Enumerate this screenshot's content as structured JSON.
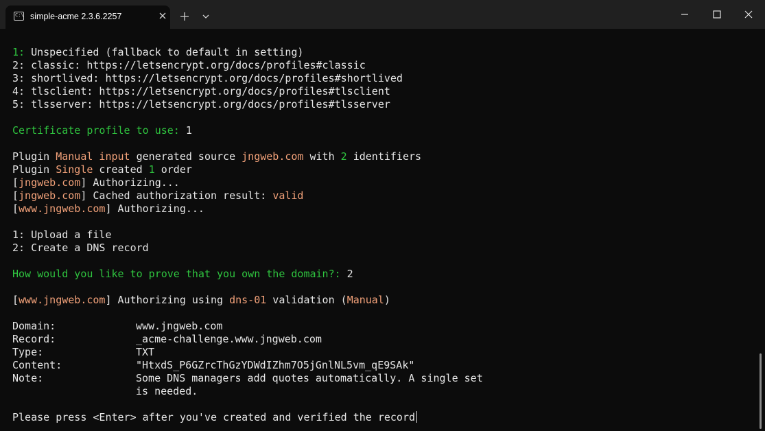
{
  "window": {
    "tab_title": "simple-acme 2.3.6.2257"
  },
  "terminal": {
    "profiles": [
      {
        "num": "1:",
        "text": " Unspecified (fallback to default in setting)"
      },
      {
        "num": "2:",
        "text": " classic: https://letsencrypt.org/docs/profiles#classic"
      },
      {
        "num": "3:",
        "text": " shortlived: https://letsencrypt.org/docs/profiles#shortlived"
      },
      {
        "num": "4:",
        "text": " tlsclient: https://letsencrypt.org/docs/profiles#tlsclient"
      },
      {
        "num": "5:",
        "text": " tlsserver: https://letsencrypt.org/docs/profiles#tlsserver"
      }
    ],
    "profile_prompt": "Certificate profile to use:",
    "profile_answer": " 1",
    "plugin1": [
      "Plugin ",
      "Manual input",
      " generated source ",
      "jngweb.com",
      " with ",
      "2",
      " identifiers"
    ],
    "plugin2": [
      "Plugin ",
      "Single",
      " created ",
      "1",
      " order"
    ],
    "auth1": [
      "[",
      "jngweb.com",
      "] Authorizing..."
    ],
    "auth2": [
      "[",
      "jngweb.com",
      "] Cached authorization result: ",
      "valid"
    ],
    "auth3": [
      "[",
      "www.jngweb.com",
      "] Authorizing..."
    ],
    "methods": [
      {
        "num": "1:",
        "text": " Upload a file"
      },
      {
        "num": "2:",
        "text": " Create a DNS record"
      }
    ],
    "method_prompt": "How would you like to prove that you own the domain?:",
    "method_answer": " 2",
    "auth4": [
      "[",
      "www.jngweb.com",
      "] Authorizing using ",
      "dns-01",
      " validation (",
      "Manual",
      ")"
    ],
    "record": [
      {
        "key": "Domain:",
        "value": "www.jngweb.com"
      },
      {
        "key": "Record:",
        "value": "_acme-challenge.www.jngweb.com"
      },
      {
        "key": "Type:",
        "value": "TXT"
      },
      {
        "key": "Content:",
        "value": "\"HtxdS_P6GZrcThGzYDWdIZhm7O5jGnlNL5vm_qE9SAk\""
      },
      {
        "key": "Note:",
        "value": "Some DNS managers add quotes automatically. A single set"
      },
      {
        "key": "",
        "value": "is needed."
      }
    ],
    "final_prompt": "Please press <Enter> after you've created and verified the record"
  }
}
